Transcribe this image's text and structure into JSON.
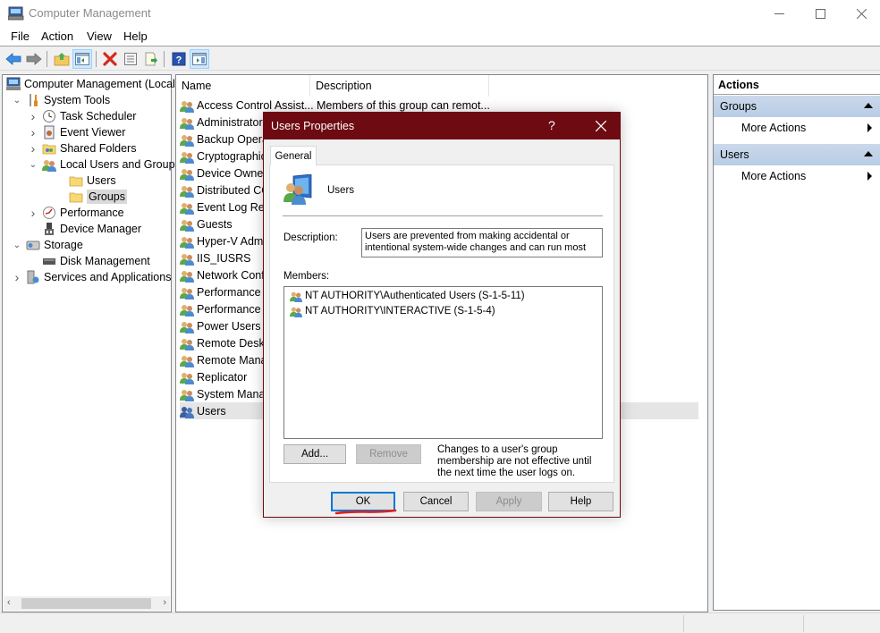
{
  "window": {
    "title": "Computer Management",
    "controls": {
      "minimize": "minimize",
      "maximize": "maximize",
      "close": "close"
    }
  },
  "menubar": {
    "items": [
      "File",
      "Action",
      "View",
      "Help"
    ]
  },
  "toolbar": {
    "buttons": [
      "back-arrow",
      "forward-arrow",
      "up-folder",
      "show-hide-console-tree",
      "delete",
      "properties",
      "export-list",
      "help",
      "show-hide-action-pane"
    ]
  },
  "tree": {
    "items": [
      {
        "label": "Computer Management (Local",
        "level": 0,
        "expander": "none",
        "icon": "computer-management-icon"
      },
      {
        "label": "System Tools",
        "level": 1,
        "expander": "expanded",
        "icon": "tools-icon"
      },
      {
        "label": "Task Scheduler",
        "level": 2,
        "expander": "collapsed",
        "icon": "clock-icon"
      },
      {
        "label": "Event Viewer",
        "level": 2,
        "expander": "collapsed",
        "icon": "event-viewer-icon"
      },
      {
        "label": "Shared Folders",
        "level": 2,
        "expander": "collapsed",
        "icon": "shared-folder-icon"
      },
      {
        "label": "Local Users and Groups",
        "level": 2,
        "expander": "expanded",
        "icon": "users-groups-icon"
      },
      {
        "label": "Users",
        "level": 3,
        "expander": "none",
        "icon": "folder-icon"
      },
      {
        "label": "Groups",
        "level": 3,
        "expander": "none",
        "icon": "folder-icon",
        "selected": true
      },
      {
        "label": "Performance",
        "level": 2,
        "expander": "collapsed",
        "icon": "performance-icon"
      },
      {
        "label": "Device Manager",
        "level": 2,
        "expander": "none",
        "icon": "device-manager-icon"
      },
      {
        "label": "Storage",
        "level": 1,
        "expander": "expanded",
        "icon": "storage-icon"
      },
      {
        "label": "Disk Management",
        "level": 2,
        "expander": "none",
        "icon": "disk-icon"
      },
      {
        "label": "Services and Applications",
        "level": 1,
        "expander": "collapsed",
        "icon": "services-icon"
      }
    ]
  },
  "list": {
    "columns": [
      "Name",
      "Description"
    ],
    "rows": [
      {
        "name": "Access Control Assist...",
        "description": "Members of this group can remot..."
      },
      {
        "name": "Administrators",
        "description": ""
      },
      {
        "name": "Backup Operators",
        "description": ""
      },
      {
        "name": "Cryptographic Operators",
        "description": ""
      },
      {
        "name": "Device Owners",
        "description": ""
      },
      {
        "name": "Distributed COM Users",
        "description": ""
      },
      {
        "name": "Event Log Readers",
        "description": ""
      },
      {
        "name": "Guests",
        "description": ""
      },
      {
        "name": "Hyper-V Administrators",
        "description": ""
      },
      {
        "name": "IIS_IUSRS",
        "description": ""
      },
      {
        "name": "Network Configuration Operators",
        "description": ""
      },
      {
        "name": "Performance Log Users",
        "description": ""
      },
      {
        "name": "Performance Monitor Users",
        "description": ""
      },
      {
        "name": "Power Users",
        "description": ""
      },
      {
        "name": "Remote Desktop Users",
        "description": ""
      },
      {
        "name": "Remote Management Users",
        "description": ""
      },
      {
        "name": "Replicator",
        "description": ""
      },
      {
        "name": "System Managed Accounts Group",
        "description": ""
      },
      {
        "name": "Users",
        "description": "",
        "selected": true
      }
    ]
  },
  "actions": {
    "header": "Actions",
    "sections": [
      {
        "title": "Groups",
        "items": [
          "More Actions"
        ]
      },
      {
        "title": "Users",
        "items": [
          "More Actions"
        ]
      }
    ]
  },
  "dialog": {
    "title": "Users Properties",
    "help_glyph": "?",
    "tabs": [
      "General"
    ],
    "group_name": "Users",
    "description_label": "Description:",
    "description_value": "Users are prevented from making accidental or intentional system-wide changes and can run most",
    "members_label": "Members:",
    "members": [
      "NT AUTHORITY\\Authenticated Users (S-1-5-11)",
      "NT AUTHORITY\\INTERACTIVE (S-1-5-4)"
    ],
    "add_button": "Add...",
    "remove_button": "Remove",
    "note": "Changes to a user's group membership are not effective until the next time the user logs on.",
    "ok_button": "OK",
    "cancel_button": "Cancel",
    "apply_button": "Apply",
    "help_button": "Help"
  },
  "colors": {
    "dialog_titlebar": "#6d0a12",
    "default_button_border": "#0078d7",
    "annotation_underline": "#e0201b",
    "actions_section": "#bcd0e8"
  }
}
